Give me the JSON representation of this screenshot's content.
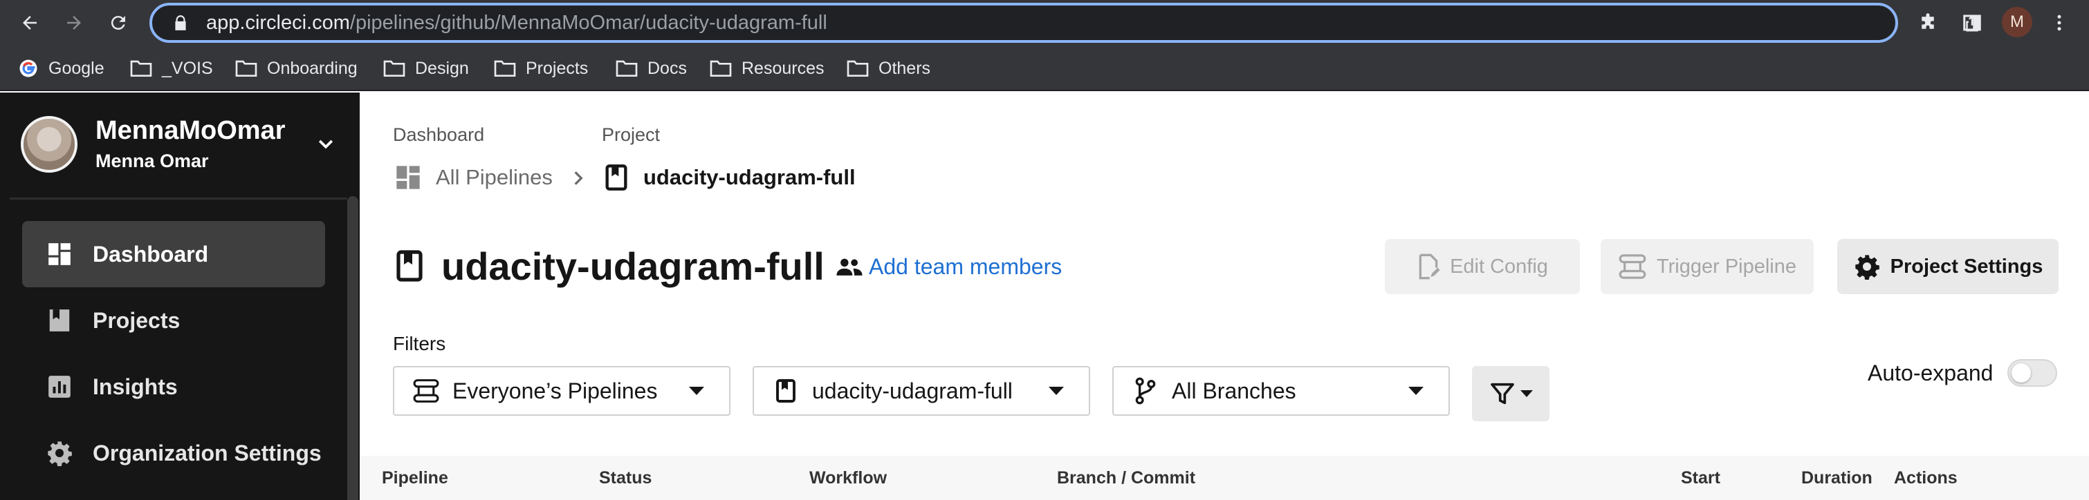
{
  "browser": {
    "url_host": "app.circleci.com",
    "url_path": "/pipelines/github/MennaMoOmar/udacity-udagram-full",
    "profile_initial": "M",
    "bookmarks": [
      "Google",
      "_VOIS",
      "Onboarding",
      "Design",
      "Projects",
      "Docs",
      "Resources",
      "Others"
    ]
  },
  "sidebar": {
    "org_name": "MennaMoOmar",
    "user_name": "Menna Omar",
    "items": [
      {
        "label": "Dashboard",
        "icon": "dashboard-icon",
        "active": true
      },
      {
        "label": "Projects",
        "icon": "projects-icon",
        "active": false
      },
      {
        "label": "Insights",
        "icon": "insights-icon",
        "active": false
      },
      {
        "label": "Organization Settings",
        "icon": "gear-icon",
        "active": false
      }
    ]
  },
  "breadcrumb": {
    "dashboard_label": "Dashboard",
    "project_label": "Project",
    "all_pipelines": "All Pipelines",
    "project_name": "udacity-udagram-full"
  },
  "header": {
    "title": "udacity-udagram-full",
    "add_team": "Add team members",
    "edit_config": "Edit Config",
    "trigger_pipeline": "Trigger Pipeline",
    "project_settings": "Project Settings"
  },
  "filters": {
    "label": "Filters",
    "pipelines": "Everyone’s Pipelines",
    "project": "udacity-udagram-full",
    "branches": "All Branches",
    "auto_expand": "Auto-expand",
    "auto_expand_on": false
  },
  "table": {
    "columns": [
      "Pipeline",
      "Status",
      "Workflow",
      "Branch / Commit",
      "Start",
      "Duration",
      "Actions"
    ]
  },
  "colors": {
    "accent_link": "#1e6fd2",
    "sidebar_bg": "#161616",
    "url_focus": "#8ab4f8"
  }
}
